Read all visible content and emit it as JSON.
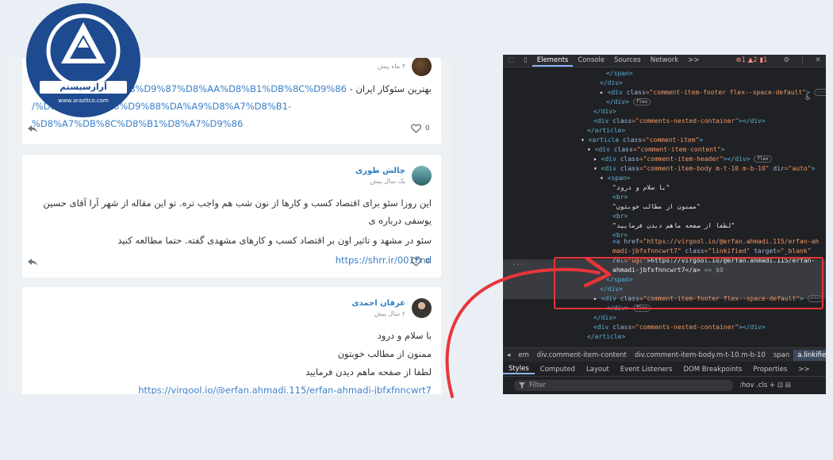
{
  "brand": {
    "name": "آرازسیستم",
    "site": "www.arazitco.com",
    "colors": {
      "navy": "#1e4a8f",
      "white": "#ffffff"
    }
  },
  "comments": [
    {
      "time": "۳ ماه پیش",
      "text": "بهترین سئوکار ایران -",
      "link1": "r.ir/%D8%A8%D9%87%D8%AA%D8%B1%DB%8C%D9%86",
      "link2": "/%D8%B3%D8%A6%D9%88%DA%A9%D8%A7%D8%B1-%D8%A7%DB%8C%D8%B1%D8%A7%D9%86"
    },
    {
      "name": "چالش طوری",
      "time": "یک سال پیش",
      "text1": "این روزا سئو برای اقتصاد کسب و کارها از نون شب هم واجب تره. تو این مقاله از شهر آرا آقای حسین یوسفی درباره ی",
      "text2": "سئو در مشهد و تاثیر اون بر اقتصاد کسب و کارهای مشهدی گفته. حتما مطالعه کنید",
      "link": "https://shrr.ir/001Fnd"
    },
    {
      "name": "عرفان احمدی",
      "time": "۲ سال پیش",
      "line1": "با سلام و درود",
      "line2": "ممنون از مطالب خوبتون",
      "line3": "لطفا از صفحه ماهم دیدن فرمایید",
      "link": "https://virgool.io/@erfan.ahmadi.115/erfan-ahmadi-jbfxfnncwrt7"
    }
  ],
  "like_count": "0",
  "devtools": {
    "tabs": [
      "Elements",
      "Console",
      "Sources",
      "Network",
      ">>"
    ],
    "active_tab": "Elements",
    "badges": "⊗1 ▲2 ▮1",
    "breadcrumbs": [
      "em",
      "div.comment-item-content",
      "div.comment-item-body.m-t-10.m-b-10",
      "span",
      "a.linkified"
    ],
    "active_crumb": "a.linkified",
    "style_tabs": [
      "Styles",
      "Computed",
      "Layout",
      "Event Listeners",
      "DOM Breakpoints",
      "Properties",
      ">>"
    ],
    "active_style_tab": "Styles",
    "filter_placeholder": "Filter",
    "filter_tools": ":hov  .cls  +  ⊡  ⊟",
    "code": {
      "l1": "</span>",
      "l2": "</div>",
      "l3a": "<div ",
      "l3b": "class",
      "l3c": "=\"comment-item-footer flex--space-default\"",
      "l3d": ">",
      "l4": "</div>",
      "l5": "</div>",
      "l6a": "<div ",
      "l6b": "class",
      "l6c": "=\"comments-nested-container\"",
      "l6d": "></div>",
      "l7": "</article>",
      "l8a": "<article ",
      "l8b": "class",
      "l8c": "=\"comment-item\"",
      "l8d": ">",
      "l9a": "<div ",
      "l9b": "class",
      "l9c": "=\"comment-item-content\"",
      "l9d": ">",
      "l10a": "<div ",
      "l10b": "class",
      "l10c": "=\"comment-item-header\"",
      "l10d": "></div>",
      "l11a": "<div ",
      "l11b": "class",
      "l11c": "=\"comment-item-body m-t-10 m-b-10\"",
      "l11e": " dir",
      "l11f": "=\"auto\"",
      "l11d": ">",
      "l12": "<span>",
      "l13": "\"با سلام و درود\"",
      "l14": "<br>",
      "l15": "\"ممنون از مطالب خوبتون\"",
      "l16": "<br>",
      "l17": "\"لطفا از صفحه ماهم دیدن فرمایید\"",
      "l18": "<br>",
      "l19a": "<a ",
      "l19b": "href",
      "l19c": "=\"https://virgool.io/@erfan.ahmadi.115/erfan-ah",
      "l20": "madi-jbfxfnncwrt7\"",
      "l20b": " class",
      "l20c": "=\"linkified\"",
      "l20e": " target",
      "l20f": "=\"_blank\"",
      "l21a": "rel",
      "l21b": "=\"ugc\"",
      "l21c": ">https://virgool.io/@erfan.ahmadi.115/erfan-",
      "l22": "ahmadi-jbfxfnncwrt7</a>",
      "l22b": " == $0",
      "l23": "</span>",
      "l24": "</div>",
      "l25a": "<div ",
      "l25b": "class",
      "l25c": "=\"comment-item-footer flex--space-default\"",
      "l25d": ">",
      "l26": "</div>",
      "l27": "</div>",
      "l28a": "<div ",
      "l28b": "class",
      "l28c": "=\"comments-nested-container\"",
      "l28d": "></div>",
      "l29": "</article>",
      "pill_flex": "flex",
      "ellipsis": "···"
    }
  }
}
